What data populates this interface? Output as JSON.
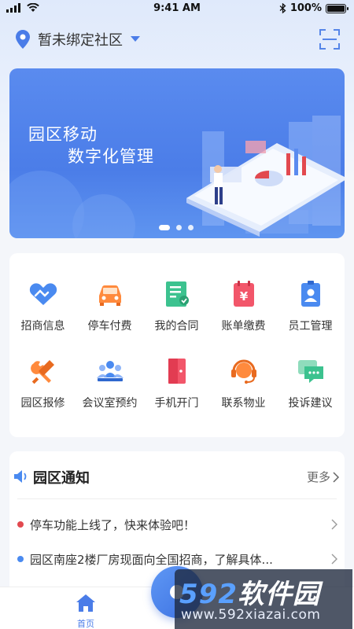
{
  "status_bar": {
    "time": "9:41 AM",
    "battery": "100%"
  },
  "header": {
    "location": "暂未绑定社区"
  },
  "banner": {
    "line1": "园区移动",
    "line2": "数字化管理",
    "active_slide": 1,
    "slide_count": 3
  },
  "grid": [
    {
      "label": "招商信息",
      "icon": "handshake-icon",
      "color": "#4a8af0"
    },
    {
      "label": "停车付费",
      "icon": "car-icon",
      "color": "#ff8a3d"
    },
    {
      "label": "我的合同",
      "icon": "contract-icon",
      "color": "#3cc28f"
    },
    {
      "label": "账单缴费",
      "icon": "bill-icon",
      "color": "#f2566a"
    },
    {
      "label": "员工管理",
      "icon": "employee-icon",
      "color": "#4a8af0"
    },
    {
      "label": "园区报修",
      "icon": "repair-icon",
      "color": "#ff8a3d"
    },
    {
      "label": "会议室预约",
      "icon": "meeting-icon",
      "color": "#4a8af0"
    },
    {
      "label": "手机开门",
      "icon": "door-icon",
      "color": "#f2566a"
    },
    {
      "label": "联系物业",
      "icon": "headset-icon",
      "color": "#ff8a3d"
    },
    {
      "label": "投诉建议",
      "icon": "chat-icon",
      "color": "#3cc28f"
    }
  ],
  "notice": {
    "title": "园区通知",
    "more": "更多",
    "items": [
      {
        "text": "停车功能上线了，快来体验吧！",
        "color": "#e2494f"
      },
      {
        "text": "园区南座2楼厂房现面向全国招商，了解具体...",
        "color": "#4a8af0"
      }
    ]
  },
  "tabbar": {
    "home_label": "首页"
  },
  "watermark": {
    "logo_num": "592",
    "logo_cn": "软件园",
    "url": "www.592xiazai.com"
  }
}
